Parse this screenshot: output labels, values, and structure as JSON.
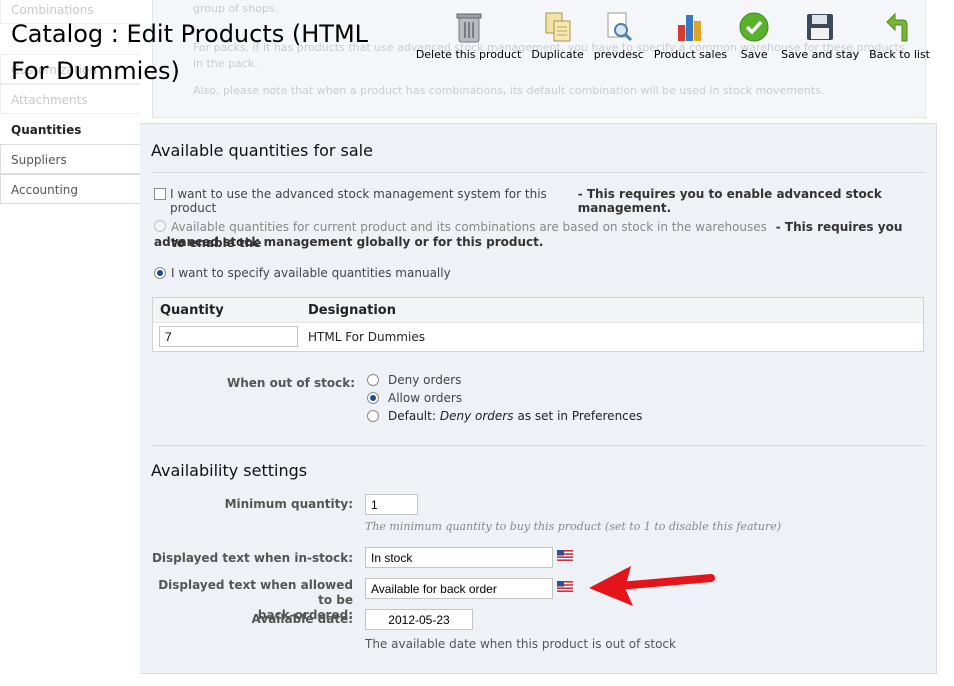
{
  "page": {
    "title": "Catalog : Edit Products (HTML For Dummies)"
  },
  "tabs": [
    {
      "label": "Combinations",
      "state": "faded"
    },
    {
      "label": "Customization",
      "state": "faded"
    },
    {
      "label": "Attachments",
      "state": "faded"
    },
    {
      "label": "Quantities",
      "state": "active"
    },
    {
      "label": "Suppliers",
      "state": "normal"
    },
    {
      "label": "Accounting",
      "state": "normal"
    }
  ],
  "toolbar": {
    "delete": "Delete this product",
    "duplicate": "Duplicate",
    "preview": "prevdesc",
    "sales": "Product sales",
    "save": "Save",
    "save_stay": "Save and stay",
    "back": "Back to list"
  },
  "background_notes": {
    "line1": "group of shops.",
    "line2": "For packs, if it has products that use advanced stock management, you have to specify a common warehouse for these products in the pack.",
    "line3": "Also, please note that when a product has combinations, its default combination will be used in stock movements."
  },
  "quantities": {
    "title": "Available quantities for sale",
    "option_advanced": "I want to use the advanced stock management system for this product",
    "option_advanced_note": "- This requires you to enable advanced stock management.",
    "option_warehouse": "Available quantities for current product and its combinations are based on stock in the warehouses",
    "option_warehouse_note1": "- This requires you to enable the",
    "option_warehouse_note2": "advanced stock management globally or for this product.",
    "option_manual": "I want to specify available quantities manually",
    "table": {
      "col_quantity": "Quantity",
      "col_designation": "Designation",
      "quantity_value": "7",
      "designation_value": "HTML For Dummies"
    },
    "out_of_stock": {
      "label": "When out of stock:",
      "deny": "Deny orders",
      "allow": "Allow orders",
      "default_prefix": "Default:",
      "default_value": "Deny orders",
      "default_suffix": "as set in Preferences",
      "selected": "allow"
    }
  },
  "availability": {
    "title": "Availability settings",
    "min_qty_label": "Minimum quantity:",
    "min_qty_value": "1",
    "min_qty_hint": "The minimum quantity to buy this product (set to 1 to disable this feature)",
    "in_stock_label": "Displayed text when in-stock:",
    "in_stock_value": "In stock",
    "backorder_label_1": "Displayed text when allowed to be",
    "backorder_label_2": "back-ordered:",
    "backorder_value": "Available for back order",
    "date_label": "Available date:",
    "date_value": "2012-05-23",
    "date_hint": "The available date when this product is out of stock"
  },
  "colors": {
    "arrow": "#e4141b",
    "panel_bg": "#eef1f6",
    "radio_fill": "#1a4f8f"
  }
}
